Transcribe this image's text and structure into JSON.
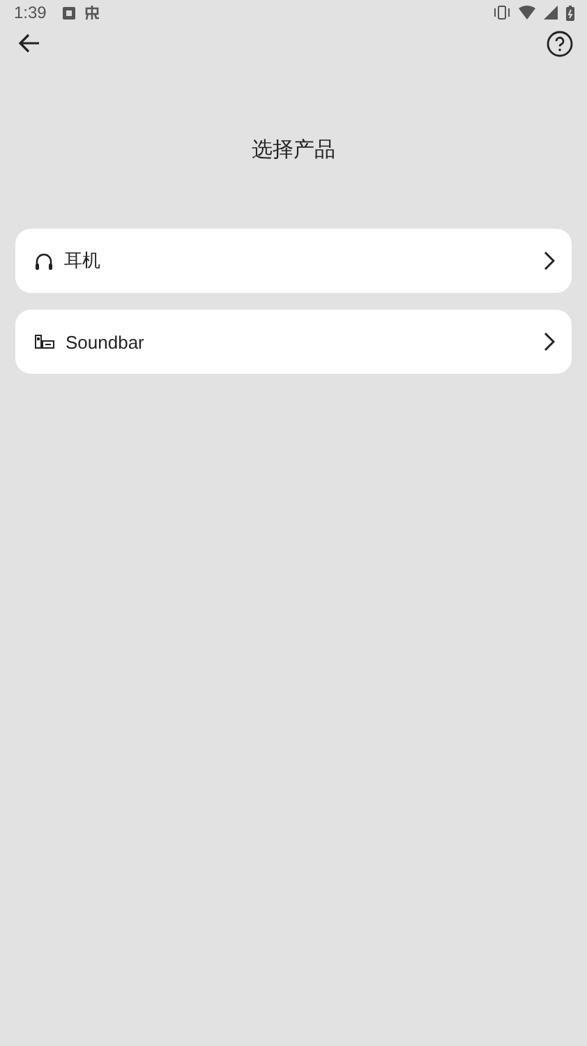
{
  "status_bar": {
    "time": "1:39"
  },
  "title": "选择产品",
  "products": [
    {
      "kind": "headphones",
      "label": "耳机"
    },
    {
      "kind": "soundbar",
      "label": "Soundbar"
    }
  ]
}
